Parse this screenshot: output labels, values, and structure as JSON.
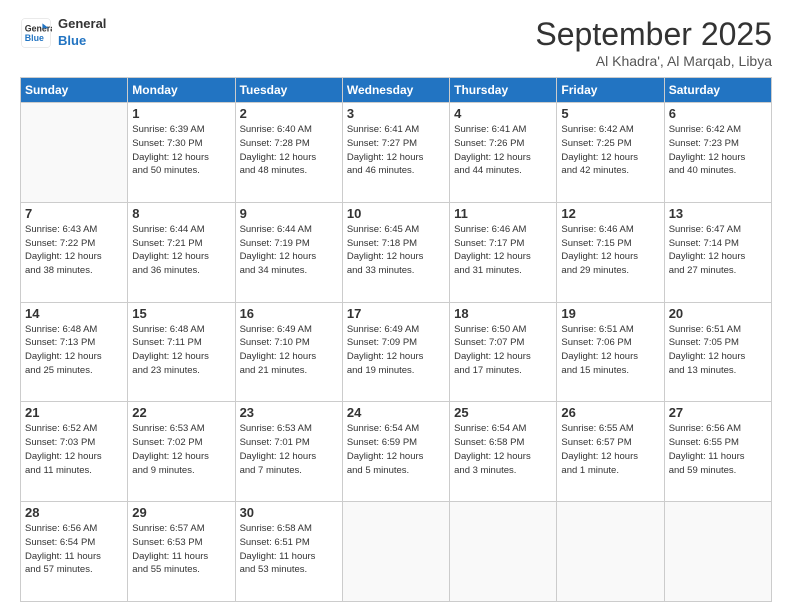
{
  "logo": {
    "line1": "General",
    "line2": "Blue"
  },
  "title": "September 2025",
  "location": "Al Khadra', Al Marqab, Libya",
  "days_header": [
    "Sunday",
    "Monday",
    "Tuesday",
    "Wednesday",
    "Thursday",
    "Friday",
    "Saturday"
  ],
  "weeks": [
    [
      {
        "day": "",
        "info": ""
      },
      {
        "day": "1",
        "info": "Sunrise: 6:39 AM\nSunset: 7:30 PM\nDaylight: 12 hours\nand 50 minutes."
      },
      {
        "day": "2",
        "info": "Sunrise: 6:40 AM\nSunset: 7:28 PM\nDaylight: 12 hours\nand 48 minutes."
      },
      {
        "day": "3",
        "info": "Sunrise: 6:41 AM\nSunset: 7:27 PM\nDaylight: 12 hours\nand 46 minutes."
      },
      {
        "day": "4",
        "info": "Sunrise: 6:41 AM\nSunset: 7:26 PM\nDaylight: 12 hours\nand 44 minutes."
      },
      {
        "day": "5",
        "info": "Sunrise: 6:42 AM\nSunset: 7:25 PM\nDaylight: 12 hours\nand 42 minutes."
      },
      {
        "day": "6",
        "info": "Sunrise: 6:42 AM\nSunset: 7:23 PM\nDaylight: 12 hours\nand 40 minutes."
      }
    ],
    [
      {
        "day": "7",
        "info": "Sunrise: 6:43 AM\nSunset: 7:22 PM\nDaylight: 12 hours\nand 38 minutes."
      },
      {
        "day": "8",
        "info": "Sunrise: 6:44 AM\nSunset: 7:21 PM\nDaylight: 12 hours\nand 36 minutes."
      },
      {
        "day": "9",
        "info": "Sunrise: 6:44 AM\nSunset: 7:19 PM\nDaylight: 12 hours\nand 34 minutes."
      },
      {
        "day": "10",
        "info": "Sunrise: 6:45 AM\nSunset: 7:18 PM\nDaylight: 12 hours\nand 33 minutes."
      },
      {
        "day": "11",
        "info": "Sunrise: 6:46 AM\nSunset: 7:17 PM\nDaylight: 12 hours\nand 31 minutes."
      },
      {
        "day": "12",
        "info": "Sunrise: 6:46 AM\nSunset: 7:15 PM\nDaylight: 12 hours\nand 29 minutes."
      },
      {
        "day": "13",
        "info": "Sunrise: 6:47 AM\nSunset: 7:14 PM\nDaylight: 12 hours\nand 27 minutes."
      }
    ],
    [
      {
        "day": "14",
        "info": "Sunrise: 6:48 AM\nSunset: 7:13 PM\nDaylight: 12 hours\nand 25 minutes."
      },
      {
        "day": "15",
        "info": "Sunrise: 6:48 AM\nSunset: 7:11 PM\nDaylight: 12 hours\nand 23 minutes."
      },
      {
        "day": "16",
        "info": "Sunrise: 6:49 AM\nSunset: 7:10 PM\nDaylight: 12 hours\nand 21 minutes."
      },
      {
        "day": "17",
        "info": "Sunrise: 6:49 AM\nSunset: 7:09 PM\nDaylight: 12 hours\nand 19 minutes."
      },
      {
        "day": "18",
        "info": "Sunrise: 6:50 AM\nSunset: 7:07 PM\nDaylight: 12 hours\nand 17 minutes."
      },
      {
        "day": "19",
        "info": "Sunrise: 6:51 AM\nSunset: 7:06 PM\nDaylight: 12 hours\nand 15 minutes."
      },
      {
        "day": "20",
        "info": "Sunrise: 6:51 AM\nSunset: 7:05 PM\nDaylight: 12 hours\nand 13 minutes."
      }
    ],
    [
      {
        "day": "21",
        "info": "Sunrise: 6:52 AM\nSunset: 7:03 PM\nDaylight: 12 hours\nand 11 minutes."
      },
      {
        "day": "22",
        "info": "Sunrise: 6:53 AM\nSunset: 7:02 PM\nDaylight: 12 hours\nand 9 minutes."
      },
      {
        "day": "23",
        "info": "Sunrise: 6:53 AM\nSunset: 7:01 PM\nDaylight: 12 hours\nand 7 minutes."
      },
      {
        "day": "24",
        "info": "Sunrise: 6:54 AM\nSunset: 6:59 PM\nDaylight: 12 hours\nand 5 minutes."
      },
      {
        "day": "25",
        "info": "Sunrise: 6:54 AM\nSunset: 6:58 PM\nDaylight: 12 hours\nand 3 minutes."
      },
      {
        "day": "26",
        "info": "Sunrise: 6:55 AM\nSunset: 6:57 PM\nDaylight: 12 hours\nand 1 minute."
      },
      {
        "day": "27",
        "info": "Sunrise: 6:56 AM\nSunset: 6:55 PM\nDaylight: 11 hours\nand 59 minutes."
      }
    ],
    [
      {
        "day": "28",
        "info": "Sunrise: 6:56 AM\nSunset: 6:54 PM\nDaylight: 11 hours\nand 57 minutes."
      },
      {
        "day": "29",
        "info": "Sunrise: 6:57 AM\nSunset: 6:53 PM\nDaylight: 11 hours\nand 55 minutes."
      },
      {
        "day": "30",
        "info": "Sunrise: 6:58 AM\nSunset: 6:51 PM\nDaylight: 11 hours\nand 53 minutes."
      },
      {
        "day": "",
        "info": ""
      },
      {
        "day": "",
        "info": ""
      },
      {
        "day": "",
        "info": ""
      },
      {
        "day": "",
        "info": ""
      }
    ]
  ]
}
